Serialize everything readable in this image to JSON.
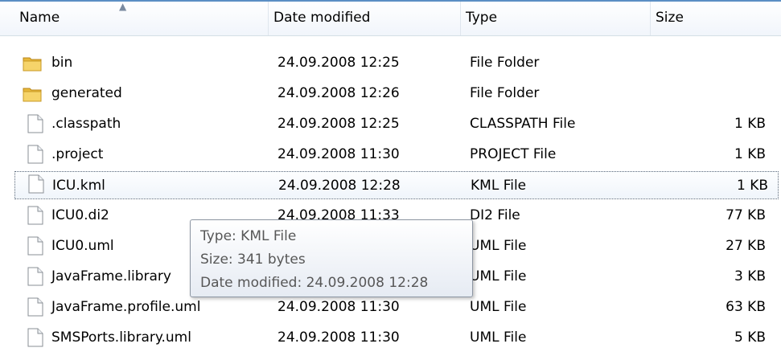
{
  "columns": {
    "name": "Name",
    "date": "Date modified",
    "type": "Type",
    "size": "Size"
  },
  "rows": [
    {
      "name": "bin",
      "date": "24.09.2008 12:25",
      "type": "File Folder",
      "size": "",
      "icon": "folder-icon"
    },
    {
      "name": "generated",
      "date": "24.09.2008 12:26",
      "type": "File Folder",
      "size": "",
      "icon": "folder-icon"
    },
    {
      "name": ".classpath",
      "date": "24.09.2008 12:25",
      "type": "CLASSPATH File",
      "size": "1 KB",
      "icon": "file-icon"
    },
    {
      "name": ".project",
      "date": "24.09.2008 11:30",
      "type": "PROJECT File",
      "size": "1 KB",
      "icon": "file-icon"
    },
    {
      "name": "ICU.kml",
      "date": "24.09.2008 12:28",
      "type": "KML File",
      "size": "1 KB",
      "icon": "file-icon"
    },
    {
      "name": "ICU0.di2",
      "date": "24.09.2008 11:33",
      "type": "DI2 File",
      "size": "77 KB",
      "icon": "file-icon"
    },
    {
      "name": "ICU0.uml",
      "date": "",
      "type": "UML File",
      "size": "27 KB",
      "icon": "file-icon"
    },
    {
      "name": "JavaFrame.library",
      "date": "",
      "type": "UML File",
      "size": "3 KB",
      "icon": "file-icon"
    },
    {
      "name": "JavaFrame.profile.uml",
      "date": "24.09.2008 11:30",
      "type": "UML File",
      "size": "63 KB",
      "icon": "file-icon"
    },
    {
      "name": "SMSPorts.library.uml",
      "date": "24.09.2008 11:30",
      "type": "UML File",
      "size": "5 KB",
      "icon": "file-icon"
    }
  ],
  "tooltip": {
    "type_line": "Type: KML File",
    "size_line": "Size: 341 bytes",
    "date_line": "Date modified: 24.09.2008 12:28"
  },
  "colors": {
    "accent": "#5b8fc4",
    "tooltip_text": "#575757"
  }
}
